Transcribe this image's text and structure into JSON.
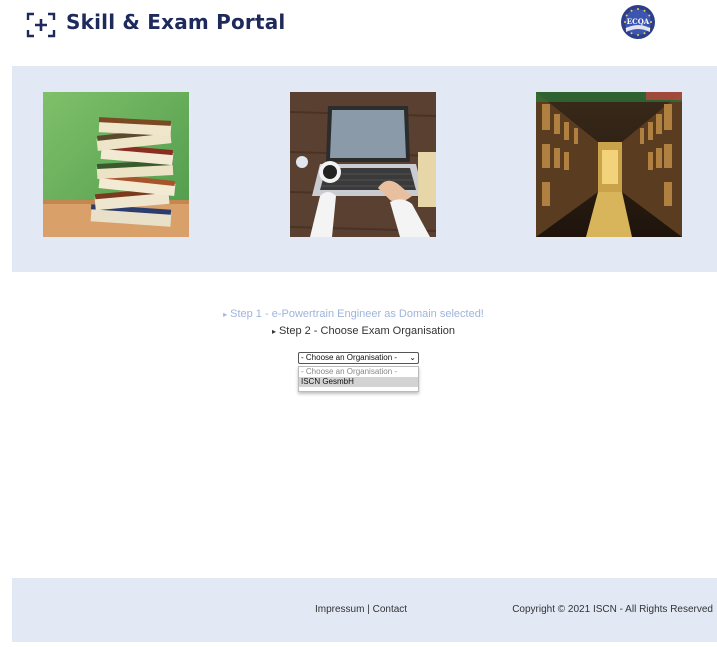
{
  "header": {
    "title": "Skill & Exam Portal",
    "badge_text": "ECQA",
    "brand_color": "#1f2a5c"
  },
  "banner": {
    "background": "#e3e8f5",
    "images": [
      "stack-of-books",
      "hands-typing-on-laptop",
      "library-shelves"
    ]
  },
  "steps": {
    "step1": "Step 1 - e-Powertrain Engineer as Domain selected!",
    "step2": "Step 2 - Choose Exam Organisation",
    "arrow": "▸"
  },
  "organisation_select": {
    "value": "- Choose an Organisation -",
    "options": [
      "- Choose an Organisation -",
      "ISCN GesmbH"
    ],
    "highlighted": "ISCN GesmbH"
  },
  "footer": {
    "impressum": "Impressum",
    "separator": "|",
    "contact": "Contact",
    "copyright": "Copyright © 2021 ISCN - All Rights Reserved"
  }
}
